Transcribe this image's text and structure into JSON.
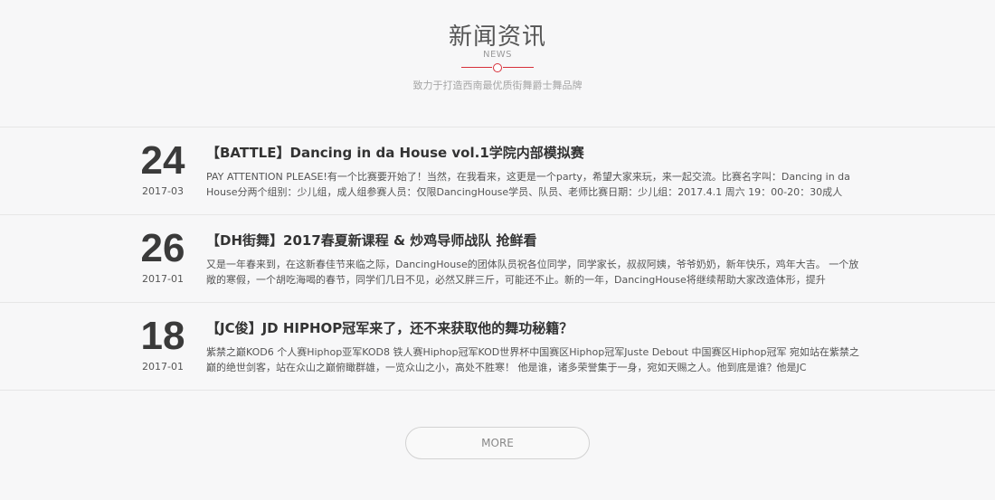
{
  "section": {
    "title": "新闻资讯",
    "subtitle": "NEWS",
    "slogan": "致力于打造西南最优质街舞爵士舞品牌"
  },
  "news": [
    {
      "day": "24",
      "year_month": "2017-03",
      "title": "【BATTLE】Dancing in da House vol.1学院内部模拟赛",
      "desc": "PAY ATTENTION PLEASE!有一个比赛要开始了！当然，在我看来，这更是一个party，希望大家来玩，来一起交流。比赛名字叫：Dancing in da House分两个组别：少儿组，成人组参赛人员：仅限DancingHouse学员、队员、老师比赛日期：少儿组：2017.4.1 周六 19：00-20：30成人"
    },
    {
      "day": "26",
      "year_month": "2017-01",
      "title": "【DH街舞】2017春夏新课程 & 炒鸡导师战队 抢鲜看",
      "desc": "又是一年春来到，在这新春佳节来临之际，DancingHouse的团体队员祝各位同学，同学家长，叔叔阿姨，爷爷奶奶，新年快乐，鸡年大吉。 一个放敞的寒假，一个胡吃海喝的春节，同学们几日不见，必然又胖三斤，可能还不止。新的一年，DancingHouse将继续帮助大家改造体形，提升"
    },
    {
      "day": "18",
      "year_month": "2017-01",
      "title": "【JC俊】JD HIPHOP冠军来了，还不来获取他的舞功秘籍？",
      "desc": "紫禁之巅KOD6 个人赛Hiphop亚军KOD8 铁人赛Hiphop冠军KOD世界杯中国赛区Hiphop冠军Juste Debout 中国赛区Hiphop冠军   宛如站在紫禁之巅的绝世剑客，站在众山之巅俯瞰群雄，一览众山之小，高处不胜寒！   他是谁，诸多荣誉集于一身，宛如天赐之人。他到底是谁？他是JC"
    }
  ],
  "more_button": {
    "label": "MORE"
  },
  "colors": {
    "accent": "#d6303a",
    "background": "#f7f7f8"
  }
}
